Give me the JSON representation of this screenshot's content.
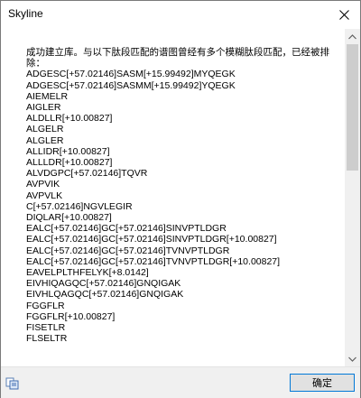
{
  "window": {
    "title": "Skyline"
  },
  "dialog": {
    "message": "成功建立库。与以下肽段匹配的谱图曾经有多个模糊肽段匹配，已经被排除：",
    "peptides": [
      "ADGESC[+57.02146]SASM[+15.99492]MYQEGK",
      "ADGESC[+57.02146]SASMM[+15.99492]YQEGK",
      "AIEMELR",
      "AIGLER",
      "ALDLLR[+10.00827]",
      "ALGELR",
      "ALGLER",
      "ALLIDR[+10.00827]",
      "ALLLDR[+10.00827]",
      "ALVDGPC[+57.02146]TQVR",
      "AVPVIK",
      "AVPVLK",
      "C[+57.02146]NGVLEGIR",
      "DIQLAR[+10.00827]",
      "EALC[+57.02146]GC[+57.02146]SINVPTLDGR",
      "EALC[+57.02146]GC[+57.02146]SINVPTLDGR[+10.00827]",
      "EALC[+57.02146]GC[+57.02146]TVNVPTLDGR",
      "EALC[+57.02146]GC[+57.02146]TVNVPTLDGR[+10.00827]",
      "EAVELPLTHFELYK[+8.0142]",
      "EIVHIQAGQC[+57.02146]GNQIGAK",
      "EIVHLQAGQC[+57.02146]GNQIGAK",
      "FGGFLR",
      "FGGFLR[+10.00827]",
      "FISETLR",
      "FLSELTR"
    ]
  },
  "footer": {
    "ok_label": "确定"
  }
}
